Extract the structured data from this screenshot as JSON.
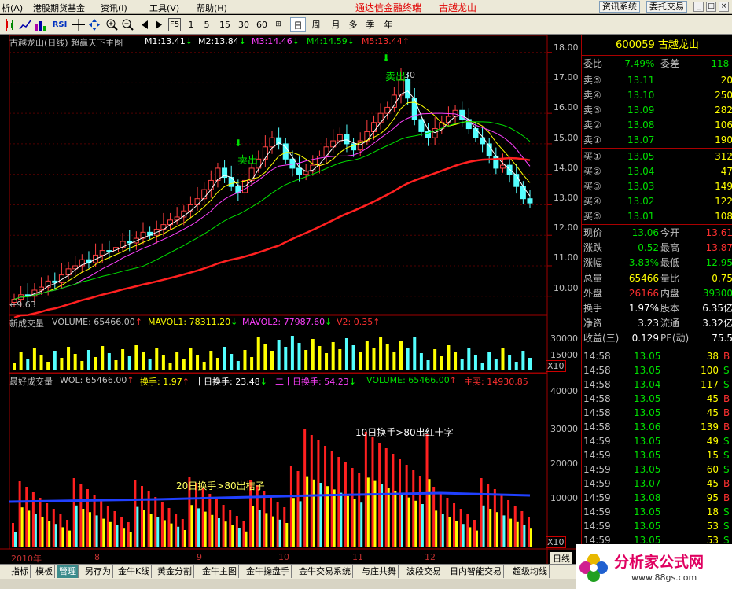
{
  "menu": {
    "items": [
      "析(A)",
      "港股期货基金",
      "资讯(I)",
      "工具(V)",
      "帮助(H)"
    ],
    "brand": "通达信金融终端",
    "stock_title": "古越龙山",
    "buttons": [
      "资讯系统",
      "委托交易"
    ]
  },
  "toolbar": {
    "periods": [
      "F5",
      "1",
      "5",
      "15",
      "30",
      "60",
      "日",
      "周",
      "月",
      "多",
      "季",
      "年"
    ],
    "selected": "日",
    "rsi_label": "RSI"
  },
  "main_panel": {
    "title": "古越龙山(日线) 超赢天下主图",
    "mas": [
      {
        "name": "M1:",
        "value": "13.41",
        "arrow": "↓",
        "color": "#ffffff"
      },
      {
        "name": "M2:",
        "value": "13.84",
        "arrow": "↓",
        "color": "#ffffff"
      },
      {
        "name": "M3:",
        "value": "14.46",
        "arrow": "↓",
        "color": "#ff40ff"
      },
      {
        "name": "M4:",
        "value": "14.59",
        "arrow": "↓",
        "color": "#00e000"
      },
      {
        "name": "M5:",
        "value": "13.44",
        "arrow": "↑",
        "color": "#ff3030"
      }
    ],
    "annotations": {
      "sell1": "卖出",
      "sell2": "卖出",
      "high": "30",
      "low": "←9.63"
    },
    "y_ticks": [
      "18.00",
      "17.00",
      "16.00",
      "15.00",
      "14.00",
      "13.00",
      "12.00",
      "11.00",
      "10.00"
    ]
  },
  "volume_panel": {
    "title": "新成交量",
    "items": [
      {
        "text": "VOLUME: 65466.00",
        "arrow": "↑",
        "color": "#c0c0c0"
      },
      {
        "text": "MAVOL1: 78311.20",
        "arrow": "↓",
        "color": "#ffff00"
      },
      {
        "text": "MAVOL2: 77987.60",
        "arrow": "↓",
        "color": "#ff40ff"
      },
      {
        "text": "V2: 0.35",
        "arrow": "↑",
        "color": "#ff3030"
      }
    ],
    "y_ticks": [
      "30000",
      "15000",
      "X10"
    ]
  },
  "wol_panel": {
    "title": "最好成交量",
    "items": [
      {
        "text": "WOL: 65466.00",
        "arrow": "↑",
        "color": "#c0c0c0"
      },
      {
        "text": "换手: 1.97",
        "arrow": "↑",
        "color": "#ffff00"
      },
      {
        "text": "十日换手: 23.48",
        "arrow": "↓",
        "color": "#ffffff"
      },
      {
        "text": "二十日换手: 54.23",
        "arrow": "↓",
        "color": "#ff40ff"
      },
      {
        "text": "VOLUME: 65466.00",
        "arrow": "↑",
        "color": "#00e000"
      },
      {
        "text": "主买: 14930.85",
        "arrow": "",
        "color": "#ff3030"
      }
    ],
    "annotation1": "10日换手>80出红十字",
    "annotation2": "20日换手>80出桔子",
    "y_ticks": [
      "40000",
      "30000",
      "20000",
      "10000",
      "X10"
    ]
  },
  "x_axis": {
    "labels": [
      "2010年",
      "8",
      "9",
      "10",
      "11",
      "12"
    ],
    "right_label": "日线"
  },
  "quote": {
    "code_name": "600059 古越龙山",
    "weibi": {
      "label": "委比",
      "value": "-7.49%",
      "label2": "委差",
      "value2": "-118"
    },
    "asks": [
      {
        "label": "卖⑤",
        "price": "13.11",
        "vol": "20"
      },
      {
        "label": "卖④",
        "price": "13.10",
        "vol": "250"
      },
      {
        "label": "卖③",
        "price": "13.09",
        "vol": "282"
      },
      {
        "label": "卖②",
        "price": "13.08",
        "vol": "106"
      },
      {
        "label": "卖①",
        "price": "13.07",
        "vol": "190"
      }
    ],
    "bids": [
      {
        "label": "买①",
        "price": "13.05",
        "vol": "312"
      },
      {
        "label": "买②",
        "price": "13.04",
        "vol": "47"
      },
      {
        "label": "买③",
        "price": "13.03",
        "vol": "149"
      },
      {
        "label": "买④",
        "price": "13.02",
        "vol": "122"
      },
      {
        "label": "买⑤",
        "price": "13.01",
        "vol": "108"
      }
    ],
    "stats": [
      {
        "l1": "现价",
        "v1": "13.06",
        "c1": "#00e000",
        "l2": "今开",
        "v2": "13.61",
        "c2": "#ff3030"
      },
      {
        "l1": "涨跌",
        "v1": "-0.52",
        "c1": "#00e000",
        "l2": "最高",
        "v2": "13.87",
        "c2": "#ff3030"
      },
      {
        "l1": "涨幅",
        "v1": "-3.83%",
        "c1": "#00e000",
        "l2": "最低",
        "v2": "12.95",
        "c2": "#00e000"
      },
      {
        "l1": "总量",
        "v1": "65466",
        "c1": "#ffff00",
        "l2": "量比",
        "v2": "0.75",
        "c2": "#ffff00"
      },
      {
        "l1": "外盘",
        "v1": "26166",
        "c1": "#ff3030",
        "l2": "内盘",
        "v2": "39300",
        "c2": "#00e000"
      },
      {
        "l1": "换手",
        "v1": "1.97%",
        "c1": "#ffffff",
        "l2": "股本",
        "v2": "6.35亿",
        "c2": "#ffffff"
      },
      {
        "l1": "净资",
        "v1": "3.23",
        "c1": "#ffffff",
        "l2": "流通",
        "v2": "3.32亿",
        "c2": "#ffffff"
      },
      {
        "l1": "收益(三)",
        "v1": "0.129",
        "c1": "#ffffff",
        "l2": "PE(动)",
        "v2": "75.5",
        "c2": "#ffffff"
      }
    ],
    "ticks": [
      {
        "t": "14:58",
        "p": "13.05",
        "v": "38",
        "s": "B"
      },
      {
        "t": "14:58",
        "p": "13.05",
        "v": "100",
        "s": "S"
      },
      {
        "t": "14:58",
        "p": "13.04",
        "v": "117",
        "s": "S"
      },
      {
        "t": "14:58",
        "p": "13.05",
        "v": "45",
        "s": "B"
      },
      {
        "t": "14:58",
        "p": "13.05",
        "v": "45",
        "s": "B"
      },
      {
        "t": "14:58",
        "p": "13.06",
        "v": "139",
        "s": "B"
      },
      {
        "t": "14:59",
        "p": "13.05",
        "v": "49",
        "s": "S"
      },
      {
        "t": "14:59",
        "p": "13.05",
        "v": "15",
        "s": "S"
      },
      {
        "t": "14:59",
        "p": "13.05",
        "v": "60",
        "s": "S"
      },
      {
        "t": "14:59",
        "p": "13.07",
        "v": "45",
        "s": "B"
      },
      {
        "t": "14:59",
        "p": "13.08",
        "v": "95",
        "s": "B"
      },
      {
        "t": "14:59",
        "p": "13.05",
        "v": "18",
        "s": "S"
      },
      {
        "t": "14:59",
        "p": "13.05",
        "v": "53",
        "s": "S"
      },
      {
        "t": "14:59",
        "p": "13.05",
        "v": "53",
        "s": "S"
      }
    ]
  },
  "tabs": [
    "指标",
    "模板",
    "管理",
    "另存为",
    "金牛K线",
    "黄金分割",
    "金牛主图",
    "金牛操盘手",
    "金牛交易系统",
    "与庄共舞",
    "波段交易",
    "日内智能交易",
    "超级均线"
  ],
  "active_tab": "管理",
  "logo": {
    "text": "分析家公式网",
    "url": "www.88gs.com"
  },
  "chart_data": {
    "type": "candlestick",
    "y_range": [
      9.4,
      18.3
    ],
    "closes": [
      9.9,
      10.05,
      10.0,
      10.2,
      10.3,
      10.5,
      10.45,
      10.7,
      10.9,
      11.0,
      11.2,
      11.1,
      11.35,
      11.5,
      11.45,
      11.6,
      11.8,
      11.75,
      11.9,
      12.1,
      12.0,
      12.2,
      12.35,
      12.5,
      12.6,
      12.8,
      13.0,
      13.2,
      13.5,
      13.8,
      14.2,
      13.9,
      13.6,
      13.4,
      13.8,
      14.2,
      14.5,
      14.9,
      15.2,
      15.0,
      14.5,
      14.2,
      14.0,
      14.1,
      14.3,
      14.6,
      14.9,
      15.1,
      15.3,
      15.0,
      14.8,
      15.1,
      15.4,
      15.7,
      16.0,
      16.2,
      16.6,
      17.1,
      16.5,
      15.8,
      15.4,
      15.2,
      15.5,
      15.7,
      15.9,
      16.1,
      15.8,
      15.5,
      15.2,
      15.0,
      14.6,
      14.2,
      14.3,
      14.0,
      13.6,
      13.2,
      13.06
    ]
  }
}
